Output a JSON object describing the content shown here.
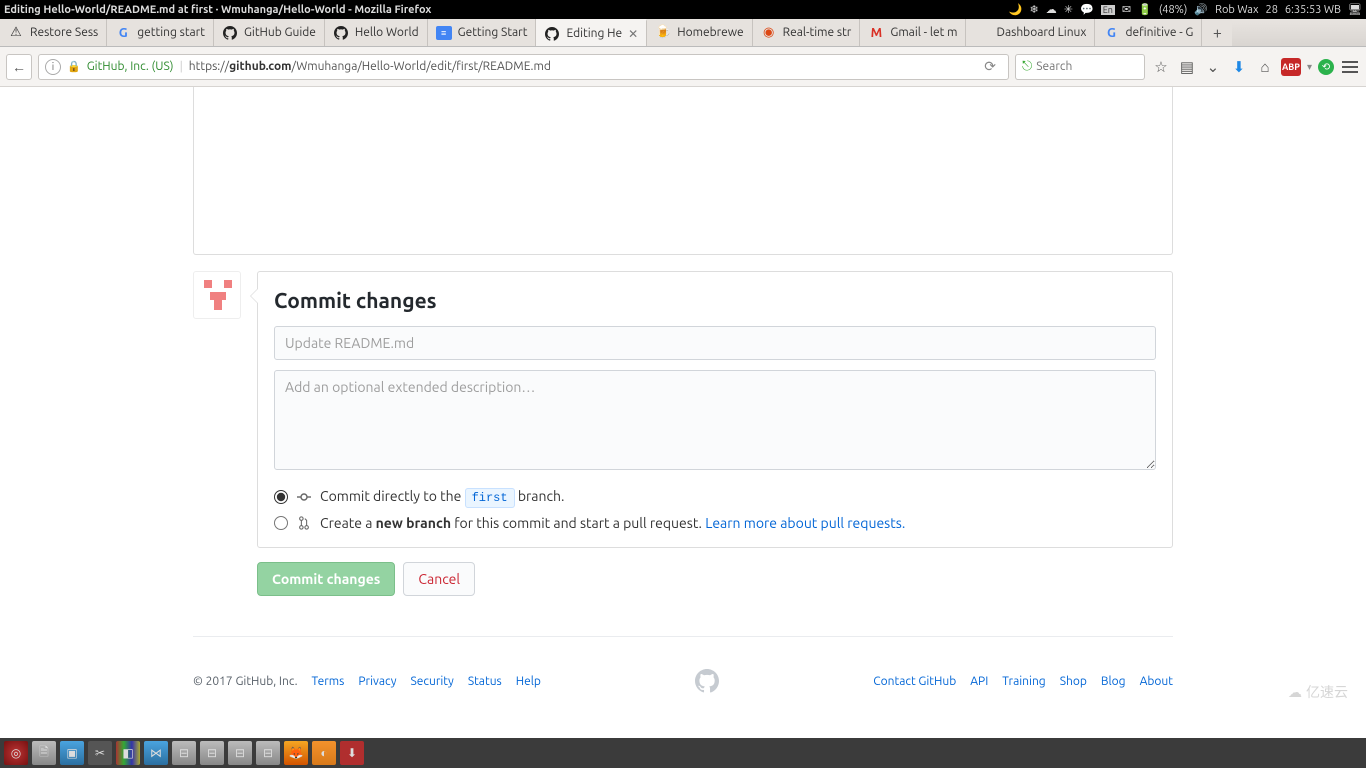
{
  "os": {
    "window_title": "Editing Hello-World/README.md at first · Wmuhanga/Hello-World - Mozilla Firefox",
    "battery": "(48%)",
    "user": "Rob Wax",
    "date": "28",
    "time": "6:35:53 WB"
  },
  "tabs": [
    {
      "label": "Restore Sess",
      "fav": "warn"
    },
    {
      "label": "getting start",
      "fav": "google"
    },
    {
      "label": "GitHub Guide",
      "fav": "github"
    },
    {
      "label": "Hello World",
      "fav": "github"
    },
    {
      "label": "Getting Start",
      "fav": "doc"
    },
    {
      "label": "Editing He",
      "fav": "github",
      "active": true,
      "close": true
    },
    {
      "label": "Homebrewe",
      "fav": "brew"
    },
    {
      "label": "Real-time str",
      "fav": "ubuntu"
    },
    {
      "label": "Gmail - let m",
      "fav": "gmail"
    },
    {
      "label": "Dashboard Linux",
      "fav": "none"
    },
    {
      "label": "definitive - G",
      "fav": "google"
    }
  ],
  "url": {
    "identity": "GitHub, Inc. (US)",
    "prefix": "https://",
    "host": "github.com",
    "path": "/Wmuhanga/Hello-World/edit/first/README.md"
  },
  "search_placeholder": "Search",
  "commit": {
    "heading": "Commit changes",
    "summary_placeholder": "Update README.md",
    "desc_placeholder": "Add an optional extended description…",
    "direct_pre": "Commit directly to the ",
    "branch": "first",
    "direct_post": " branch.",
    "newbranch_pre": "Create a ",
    "newbranch_bold": "new branch",
    "newbranch_post": " for this commit and start a pull request. ",
    "learn_link": "Learn more about pull requests.",
    "commit_btn": "Commit changes",
    "cancel_btn": "Cancel"
  },
  "footer": {
    "copyright": "© 2017 GitHub, Inc.",
    "left": [
      "Terms",
      "Privacy",
      "Security",
      "Status",
      "Help"
    ],
    "right": [
      "Contact GitHub",
      "API",
      "Training",
      "Shop",
      "Blog",
      "About"
    ]
  },
  "watermark": "亿速云"
}
